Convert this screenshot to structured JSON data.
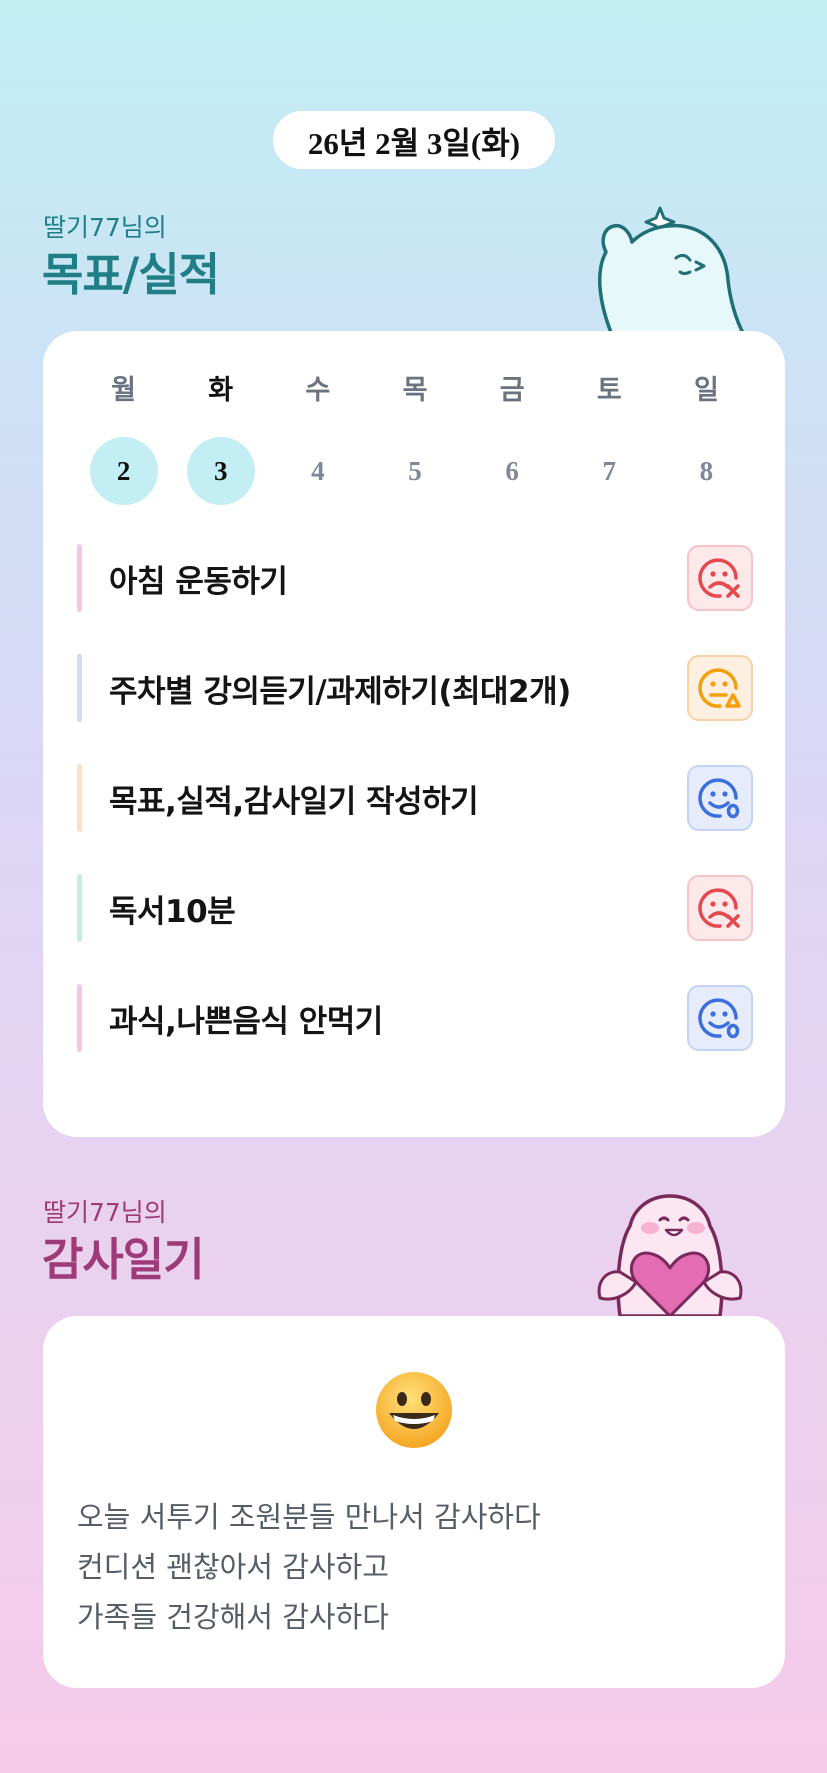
{
  "date": "26년 2월 3일(화)",
  "goals_section": {
    "subtitle": "딸기77님의",
    "title": "목표/실적"
  },
  "week": {
    "days": [
      {
        "label": "월",
        "date": "2",
        "done": true,
        "today": false
      },
      {
        "label": "화",
        "date": "3",
        "done": true,
        "today": true
      },
      {
        "label": "수",
        "date": "4",
        "done": false,
        "today": false
      },
      {
        "label": "목",
        "date": "5",
        "done": false,
        "today": false
      },
      {
        "label": "금",
        "date": "6",
        "done": false,
        "today": false
      },
      {
        "label": "토",
        "date": "7",
        "done": false,
        "today": false
      },
      {
        "label": "일",
        "date": "8",
        "done": false,
        "today": false
      }
    ]
  },
  "goals": [
    {
      "text": "아침 운동하기",
      "status": "fail",
      "bar_color": "#f8c6e0",
      "status_icon": "sad-face-x-icon"
    },
    {
      "text": "주차별 강의듣기/과제하기(최대2개)",
      "status": "partial",
      "bar_color": "#cfdcf6",
      "status_icon": "neutral-face-triangle-icon"
    },
    {
      "text": "목표,실적,감사일기 작성하기",
      "status": "success",
      "bar_color": "#fde1c2",
      "status_icon": "smile-face-o-icon"
    },
    {
      "text": "독서10분",
      "status": "fail",
      "bar_color": "#c5f0dc",
      "status_icon": "sad-face-x-icon"
    },
    {
      "text": "과식,나쁜음식 안먹기",
      "status": "success",
      "bar_color": "#f8c6e0",
      "status_icon": "smile-face-o-icon"
    }
  ],
  "gratitude_section": {
    "subtitle": "딸기77님의",
    "title": "감사일기"
  },
  "gratitude": {
    "mood_icon": "grinning-face-icon",
    "lines": [
      "오늘 서투기 조원분들 만나서 감사하다",
      "컨디션 괜찮아서 감사하고",
      "가족들 건강해서 감사하다"
    ]
  },
  "colors": {
    "fail": "#e5484d",
    "partial": "#f59e0b",
    "success": "#3b6fe0",
    "teal_title": "#1f7f85",
    "plum_title": "#9d3a78"
  }
}
